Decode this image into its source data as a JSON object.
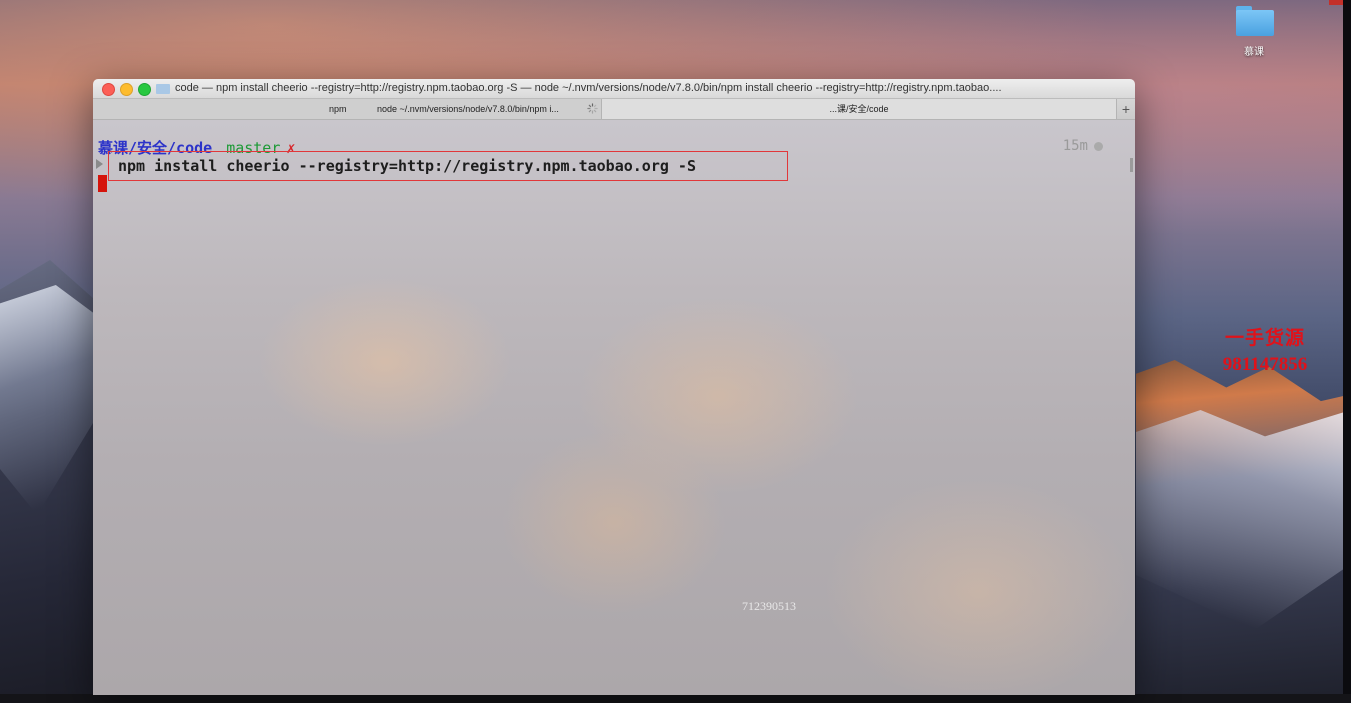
{
  "desktop": {
    "folder_label": "慕课",
    "watermark_line1": "一手货源",
    "watermark_line2": "981147856"
  },
  "terminal": {
    "window_title": "code — npm install cheerio --registry=http://registry.npm.taobao.org -S — node ~/.nvm/versions/node/v7.8.0/bin/npm install cheerio --registry=http://registry.npm.taobao....",
    "tabs": [
      {
        "name": "npm",
        "process": "node ~/.nvm/versions/node/v7.8.0/bin/npm i..."
      },
      {
        "name": "...课/安全/code"
      }
    ],
    "add_tab_label": "+",
    "prompt_path": "慕课/安全/code",
    "prompt_branch": "master",
    "prompt_dirty_mark": "✗",
    "elapsed": "15m",
    "command": "npm install cheerio --registry=http://registry.npm.taobao.org -S",
    "overlay_number": "712390513"
  },
  "colors": {
    "prompt_path": "#2c33c9",
    "prompt_branch": "#1e9a37",
    "highlight_box": "#e1373a",
    "cursor": "#d5140c",
    "watermark": "#e0121a"
  }
}
